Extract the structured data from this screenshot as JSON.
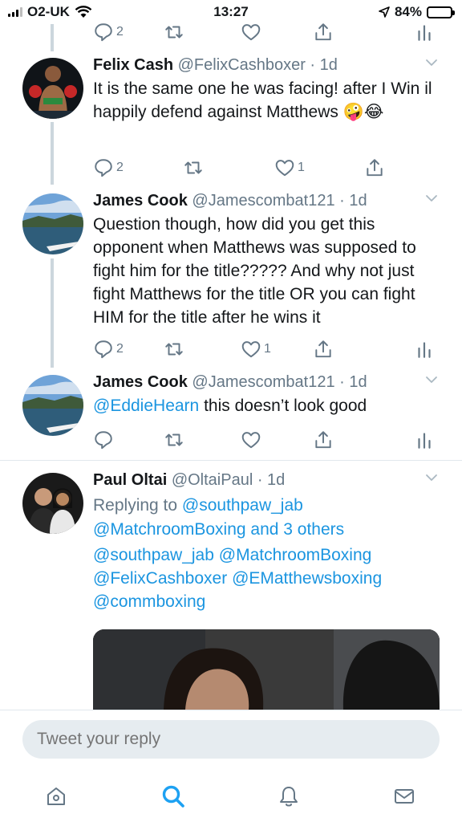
{
  "status_bar": {
    "carrier": "O2-UK",
    "time": "13:27",
    "battery": "84%",
    "battery_level": 0.84
  },
  "tweets": [
    {
      "name": "Felix Cash",
      "handle": "@FelixCashboxer",
      "time": "· 1d",
      "text": "It is the same one he was facing! after I Win il happily defend against Matthews 🤪😂",
      "replies": "2",
      "likes": "1"
    },
    {
      "name": "James Cook",
      "handle": "@Jamescombat121",
      "time": "· 1d",
      "text": "Question though, how did you get this opponent when Matthews was supposed to fight him for the title????? And why not just fight Matthews for the title OR you can fight HIM for the title after he wins it",
      "replies": "2",
      "likes": "1"
    },
    {
      "name": "James Cook",
      "handle": "@Jamescombat121",
      "time": "· 1d",
      "mention": "@EddieHearn",
      "text": " this doesn’t look good"
    },
    {
      "name": "Paul Oltai",
      "handle": "@OltaiPaul",
      "time": "· 1d",
      "replying_prefix": "Replying to ",
      "replying_user": "@southpaw_jab",
      "replying_user2": "@MatchroomBoxing",
      "replying_others": " and 3 others",
      "mentions_line1a": "@southpaw_jab",
      "mentions_line1b": "@MatchroomBoxing",
      "mentions_line2a": "@FelixCashboxer",
      "mentions_line2b": "@EMatthewsboxing",
      "mentions_line3": "@commboxing"
    }
  ],
  "top_action_row": {
    "replies": "2"
  },
  "reply_box": {
    "placeholder": "Tweet your reply"
  },
  "tab_bar": [
    "home-icon",
    "search-icon",
    "notifications-icon",
    "messages-icon"
  ],
  "colors": {
    "accent": "#1da1f2",
    "link": "#1b95e0",
    "muted": "#657786"
  }
}
